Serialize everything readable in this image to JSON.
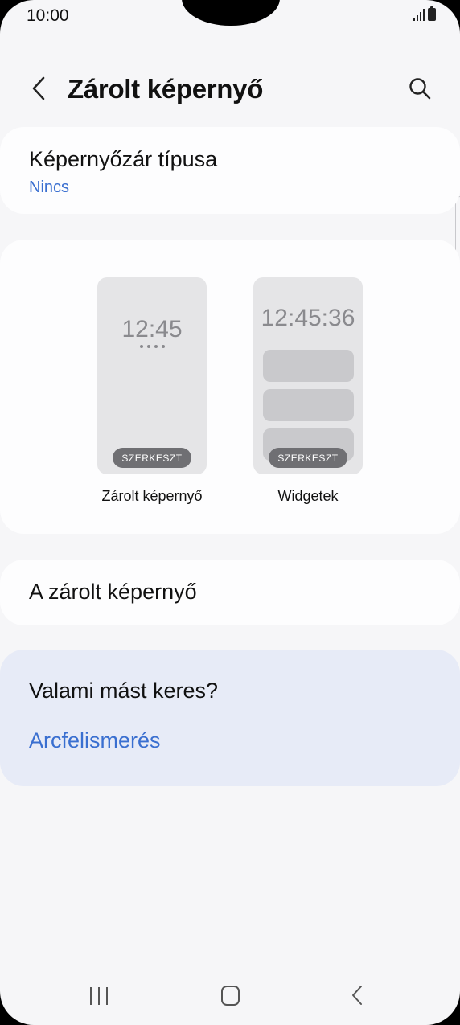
{
  "status_bar": {
    "time": "10:00"
  },
  "header": {
    "title": "Zárolt képernyő"
  },
  "lock_type": {
    "title": "Képernyőzár típusa",
    "value": "Nincs"
  },
  "preview": {
    "lock_screen": {
      "clock": "12:45",
      "edit_label": "SZERKESZT",
      "caption": "Zárolt képernyő"
    },
    "widgets": {
      "clock": "12:45:36",
      "edit_label": "SZERKESZT",
      "caption": "Widgetek"
    }
  },
  "lock_screen_item": {
    "title": "A zárolt képernyő"
  },
  "suggestion": {
    "title": "Valami mást keres?",
    "link": "Arcfelismerés"
  },
  "colors": {
    "accent": "#3a6fd0",
    "background": "#f6f6f8",
    "card": "#fdfdfe",
    "suggest_bg": "#e7ebf7"
  }
}
